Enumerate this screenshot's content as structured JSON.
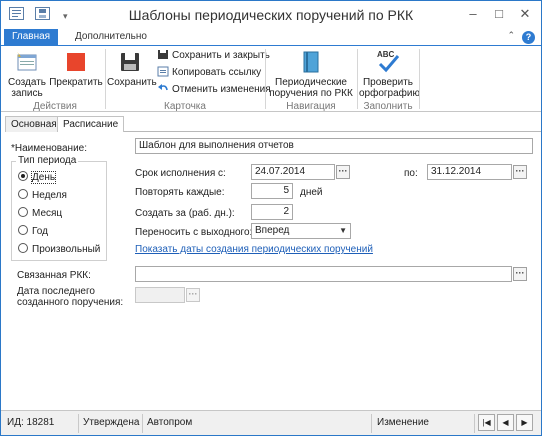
{
  "window": {
    "title": "Шаблоны периодических поручений по РКК"
  },
  "ribbon_tabs": [
    "Главная",
    "Дополнительно"
  ],
  "ribbon": {
    "create_label": "Создать запись",
    "stop_label": "Прекратить",
    "save_label": "Сохранить",
    "save_close_label": "Сохранить и закрыть",
    "copy_link_label": "Копировать ссылку",
    "undo_label": "Отменить изменения",
    "periodic_label": "Периодические поручения по РКК",
    "spell_label": "Проверить орфографию",
    "spell_icon_text": "ABC",
    "groups": {
      "actions": "Действия",
      "card": "Карточка",
      "navigation": "Навигация",
      "fill": "Заполнить"
    }
  },
  "content_tabs": [
    "Основная",
    "Расписание"
  ],
  "form": {
    "name_label": "*Наименование:",
    "name_value": "Шаблон для выполнения отчетов",
    "period_type_title": "Тип периода",
    "period_options": [
      "День",
      "Неделя",
      "Месяц",
      "Год",
      "Произвольный"
    ],
    "selected_period": "День",
    "due_from_label": "Срок исполнения с:",
    "due_from_value": "24.07.2014",
    "due_to_label": "по:",
    "due_to_value": "31.12.2014",
    "repeat_label": "Повторять каждые:",
    "repeat_value": "5",
    "repeat_unit": "дней",
    "create_before_label": "Создать за (раб. дн.):",
    "create_before_value": "2",
    "holiday_label": "Переносить с выходного:",
    "holiday_value": "Вперед",
    "show_dates_link": "Показать даты создания периодических поручений",
    "linked_rkk_label": "Связанная РКК:",
    "linked_rkk_value": "",
    "last_date_label_1": "Дата последнего",
    "last_date_label_2": "созданного поручения:",
    "last_date_value": ""
  },
  "status": {
    "id": "ИД: 18281",
    "state": "Утверждена",
    "org": "Автопром",
    "mode": "Изменение"
  },
  "colors": {
    "accent": "#2e7bd1",
    "stop_red": "#e8452c",
    "link": "#1e5fb8"
  }
}
